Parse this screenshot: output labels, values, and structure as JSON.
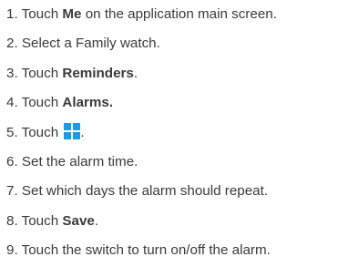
{
  "steps": [
    {
      "num": "1.",
      "pre": "Touch ",
      "bold": "Me",
      "post": " on the application main screen."
    },
    {
      "num": "2.",
      "pre": "Select a Family watch.",
      "bold": "",
      "post": ""
    },
    {
      "num": "3.",
      "pre": "Touch ",
      "bold": "Reminders",
      "post": "."
    },
    {
      "num": "4.",
      "pre": "Touch ",
      "bold": "Alarms.",
      "post": ""
    },
    {
      "num": "5.",
      "pre": "Touch ",
      "bold": "",
      "post": ".",
      "icon": "add-plus-icon",
      "icon_color": "#1a9be8"
    },
    {
      "num": "6.",
      "pre": "Set the alarm time.",
      "bold": "",
      "post": ""
    },
    {
      "num": "7.",
      "pre": "Set which days the alarm should repeat.",
      "bold": "",
      "post": ""
    },
    {
      "num": "8.",
      "pre": "Touch ",
      "bold": "Save",
      "post": "."
    },
    {
      "num": "9.",
      "pre": "Touch the switch to turn on/off the alarm.",
      "bold": "",
      "post": ""
    }
  ],
  "colors": {
    "text": "#3a3a3a",
    "icon": "#1a9be8"
  }
}
